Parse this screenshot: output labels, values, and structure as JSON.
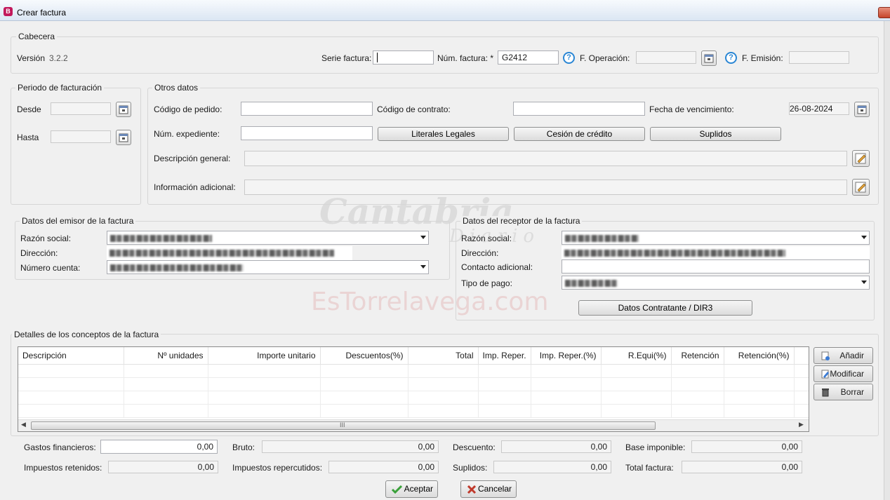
{
  "window": {
    "title": "Crear factura",
    "app_icon": "document-icon"
  },
  "header": {
    "legend": "Cabecera",
    "version_label": "Versión",
    "version_value": "3.2.2",
    "serie_label": "Serie factura:",
    "serie_value": "",
    "num_label": "Núm. factura: *",
    "num_value": "G2412",
    "fop_label": "F. Operación:",
    "fop_value": "",
    "femi_label": "F. Emisión:",
    "femi_value": ""
  },
  "period": {
    "legend": "Periodo de facturación",
    "desde_label": "Desde",
    "hasta_label": "Hasta",
    "desde_value": "",
    "hasta_value": ""
  },
  "otros": {
    "legend": "Otros datos",
    "pedido_label": "Código de pedido:",
    "pedido_value": "",
    "contrato_label": "Código de contrato:",
    "contrato_value": "",
    "venc_label": "Fecha de vencimiento:",
    "venc_value": "26-08-2024",
    "expediente_label": "Núm. expediente:",
    "expediente_value": "",
    "btn_literales": "Literales Legales",
    "btn_cesion": "Cesión de crédito",
    "btn_suplidos": "Suplidos",
    "desc_label": "Descripción general:",
    "info_label": "Información adicional:"
  },
  "emisor": {
    "legend": "Datos del emisor de la factura",
    "razon_label": "Razón social:",
    "direccion_label": "Dirección:",
    "cuenta_label": "Número cuenta:"
  },
  "receptor": {
    "legend": "Datos del receptor de la factura",
    "razon_label": "Razón social:",
    "direccion_label": "Dirección:",
    "contacto_label": "Contacto adicional:",
    "pago_label": "Tipo de pago:",
    "btn_contratante": "Datos Contratante / DIR3"
  },
  "conceptos": {
    "legend": "Detalles de los conceptos de la factura",
    "columns": [
      "Descripción",
      "Nº unidades",
      "Importe unitario",
      "Descuentos(%)",
      "Total",
      "Imp. Reper.",
      "Imp. Reper.(%)",
      "R.Equi(%)",
      "Retención",
      "Retención(%)"
    ],
    "btn_add": "Añadir",
    "btn_modify": "Modificar",
    "btn_delete": "Borrar",
    "scroll_grip": "III"
  },
  "totals": {
    "gastos_label": "Gastos financieros:",
    "gastos_value": "0,00",
    "bruto_label": "Bruto:",
    "bruto_value": "0,00",
    "descuento_label": "Descuento:",
    "descuento_value": "0,00",
    "base_label": "Base imponible:",
    "base_value": "0,00",
    "retenidos_label": "Impuestos retenidos:",
    "retenidos_value": "0,00",
    "repercutidos_label": "Impuestos repercutidos:",
    "repercutidos_value": "0,00",
    "suplidos_label": "Suplidos:",
    "suplidos_value": "0,00",
    "total_label": "Total factura:",
    "total_value": "0,00"
  },
  "footer": {
    "accept": "Aceptar",
    "cancel": "Cancelar"
  },
  "watermark": {
    "line1": "Cantabria",
    "line2": "Diario",
    "line3": "EsTorrelavega.com"
  }
}
